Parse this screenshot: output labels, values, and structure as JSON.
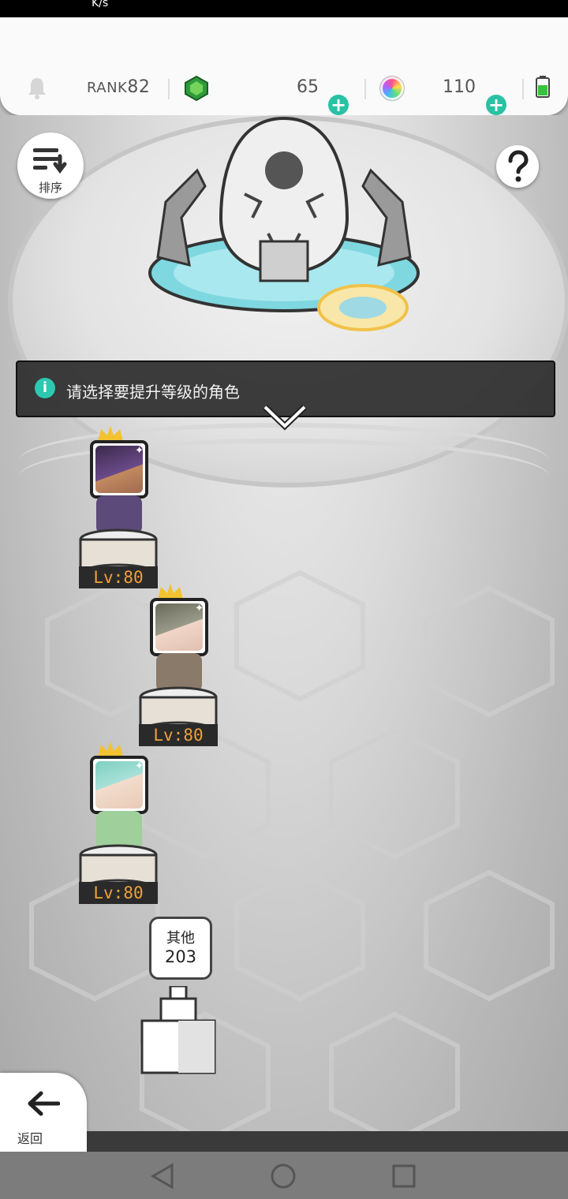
{
  "status_bar": {
    "speed_label": "K/s",
    "battery_text": ""
  },
  "header": {
    "rank_label": "RANK",
    "rank_value": "82",
    "gems": "65",
    "orbs": "110"
  },
  "sort_button": {
    "label": "排序"
  },
  "notice": {
    "text": "请选择要提升等级的角色"
  },
  "characters": [
    {
      "level": "Lv:80",
      "color": "#6a4a8a"
    },
    {
      "level": "Lv:80",
      "color": "#8a8a8a"
    },
    {
      "level": "Lv:80",
      "color": "#7ed0c0"
    }
  ],
  "others": {
    "label": "其他",
    "count": "203"
  },
  "back_button": {
    "label": "返回"
  },
  "colors": {
    "accent": "#28c2a4",
    "level_text": "#f0a03a"
  }
}
